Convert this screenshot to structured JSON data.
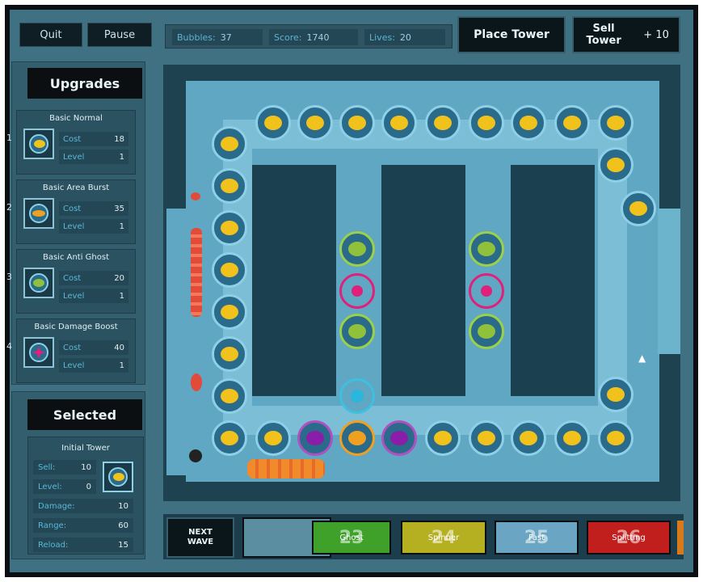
{
  "top": {
    "quit_label": "Quit",
    "pause_label": "Pause",
    "bubbles_label": "Bubbles:",
    "bubbles_value": "37",
    "score_label": "Score:",
    "score_value": "1740",
    "lives_label": "Lives:",
    "lives_value": "20",
    "place_tower_label": "Place Tower",
    "sell_tower_label": "Sell Tower",
    "sell_value": "+ 10"
  },
  "upgrades": {
    "title": "Upgrades",
    "items": [
      {
        "num": "1",
        "name": "Basic Normal",
        "cost_label": "Cost",
        "cost": "18",
        "level_label": "Level",
        "level": "1"
      },
      {
        "num": "2",
        "name": "Basic Area Burst",
        "cost_label": "Cost",
        "cost": "35",
        "level_label": "Level",
        "level": "1"
      },
      {
        "num": "3",
        "name": "Basic Anti Ghost",
        "cost_label": "Cost",
        "cost": "20",
        "level_label": "Level",
        "level": "1"
      },
      {
        "num": "4",
        "name": "Basic Damage Boost",
        "cost_label": "Cost",
        "cost": "40",
        "level_label": "Level",
        "level": "1"
      }
    ]
  },
  "selected": {
    "title": "Selected",
    "name": "Initial Tower",
    "sell_label": "Sell:",
    "sell": "10",
    "level_label": "Level:",
    "level": "0",
    "damage_label": "Damage:",
    "damage": "10",
    "range_label": "Range:",
    "range": "60",
    "reload_label": "Reload:",
    "reload": "15"
  },
  "waves": {
    "next_label": "NEXT WAVE",
    "items": [
      {
        "num": "23",
        "label": "Ghost",
        "color": "#3fa02a"
      },
      {
        "num": "24",
        "label": "Spinner",
        "color": "#b5b022"
      },
      {
        "num": "25",
        "label": "Fast",
        "color": "#6aa6c4"
      },
      {
        "num": "26",
        "label": "Splitting",
        "color": "#c11e1e"
      }
    ]
  }
}
